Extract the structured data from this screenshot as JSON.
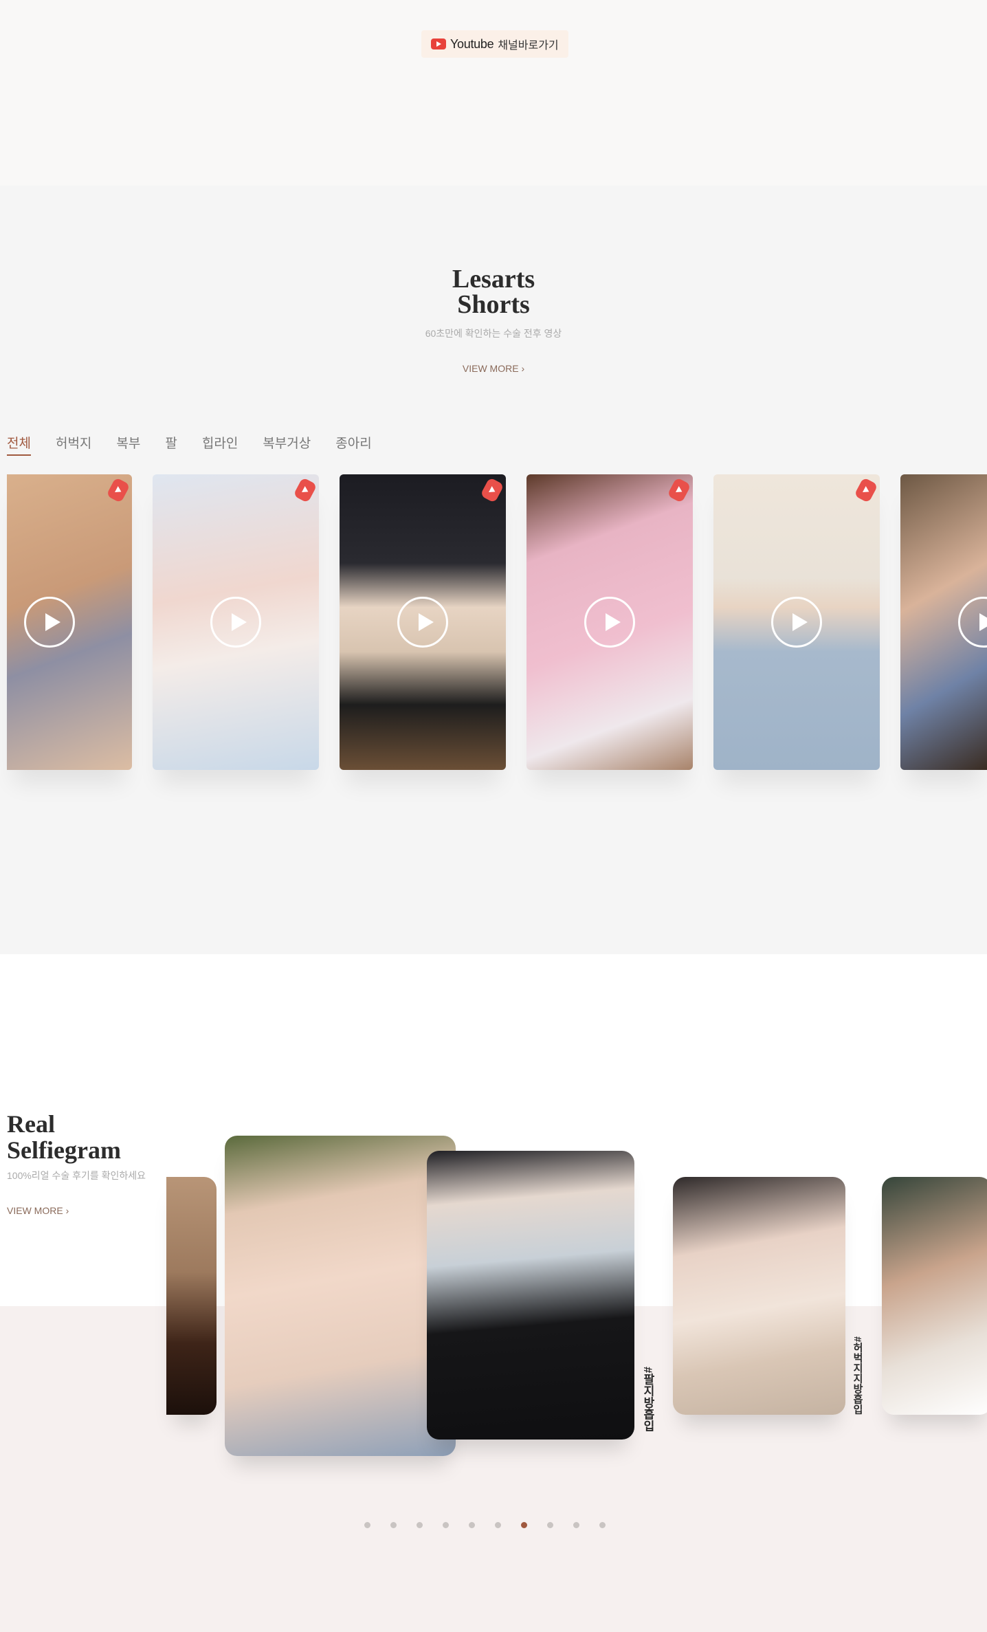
{
  "youtube": {
    "word": "Youtube",
    "label": "채널바로가기"
  },
  "shorts": {
    "title_line1": "Lesarts",
    "title_line2": "Shorts",
    "subtitle": "60초만에 확인하는 수술 전후 영상",
    "view_more": "VIEW MORE",
    "view_more_icon": "chevron-right-icon",
    "tabs": [
      "전체",
      "허벅지",
      "복부",
      "팔",
      "힙라인",
      "복부거상",
      "종아리"
    ],
    "active_tab": 0,
    "cards": [
      {
        "play_icon": "play-circle-icon",
        "badge_icon": "youtube-shorts-icon"
      },
      {
        "play_icon": "play-circle-icon",
        "badge_icon": "youtube-shorts-icon"
      },
      {
        "play_icon": "play-circle-icon",
        "badge_icon": "youtube-shorts-icon"
      },
      {
        "play_icon": "play-circle-icon",
        "badge_icon": "youtube-shorts-icon"
      },
      {
        "play_icon": "play-circle-icon",
        "badge_icon": "youtube-shorts-icon"
      },
      {
        "play_icon": "play-circle-icon",
        "badge_icon": "youtube-shorts-icon"
      }
    ]
  },
  "selfiegram": {
    "title_line1": "Real",
    "title_line2": "Selfiegram",
    "subtitle": "100%리얼 수술 후기를 확인하세요",
    "view_more": "VIEW MORE",
    "view_more_icon": "chevron-right-icon",
    "hashtags": [
      "#팔지방흡입",
      "#허벅지지방흡입"
    ],
    "pagination_count": 10,
    "active_page": 6
  },
  "colors": {
    "accent": "#a0593f",
    "youtube_red": "#e8413a",
    "band": "#f6f0ef"
  }
}
